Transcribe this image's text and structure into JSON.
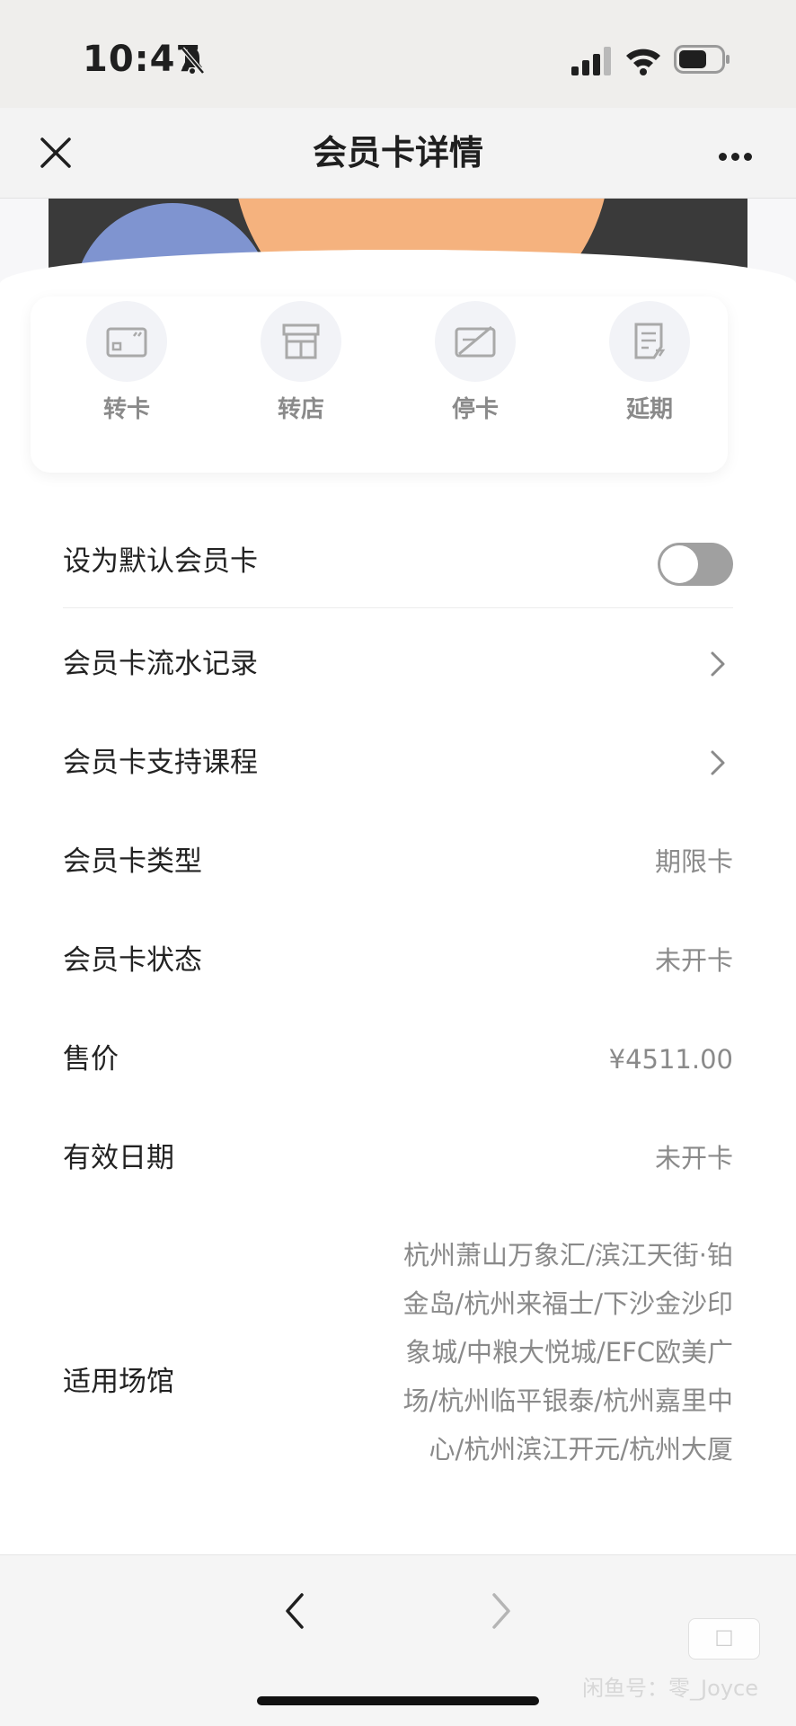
{
  "status_bar": {
    "time": "10:47"
  },
  "nav": {
    "title": "会员卡详情"
  },
  "colors": {
    "card_dark": "#3a3a3a",
    "circle_orange": "#f5b27e",
    "circle_blue": "#7f94d0",
    "page_bg": "#f7f7f9"
  },
  "actions": [
    {
      "label": "转卡",
      "icon": "transfer-card-icon"
    },
    {
      "label": "转店",
      "icon": "store-icon"
    },
    {
      "label": "停卡",
      "icon": "stop-card-icon"
    },
    {
      "label": "延期",
      "icon": "extend-document-icon"
    }
  ],
  "rows": {
    "default_label": "设为默认会员卡",
    "flow_label": "会员卡流水记录",
    "courses_label": "会员卡支持课程",
    "type_label": "会员卡类型",
    "type_value": "期限卡",
    "status_label": "会员卡状态",
    "status_value": "未开卡",
    "price_label": "售价",
    "price_value": "¥4511.00",
    "valid_label": "有效日期",
    "valid_value": "未开卡",
    "venue_label": "适用场馆",
    "venue_value": "杭州萧山万象汇/滨江天街·铂金岛/杭州来福士/下沙金沙印象城/中粮大悦城/EFC欧美广场/杭州临平银泰/杭州嘉里中心/杭州滨江开元/杭州大厦"
  },
  "watermark": {
    "text": "闲鱼号：零_Joyce"
  }
}
